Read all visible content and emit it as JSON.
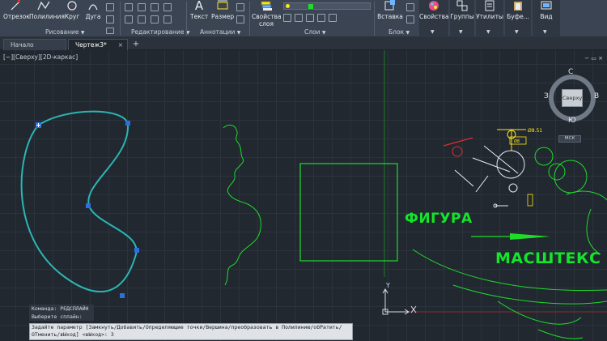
{
  "ribbon": {
    "draw_tools": [
      "Отрезок",
      "Полилиния",
      "Круг",
      "Дуга"
    ],
    "modify_tools": [
      "Текст",
      "Размер"
    ],
    "layers_tool": [
      "Свойства",
      "слоя"
    ],
    "insert_tool": "Вставка",
    "right_tools": [
      "Свойства",
      "Группы",
      "Утилиты",
      "Буфе...",
      "Вид"
    ],
    "panels": {
      "draw": "Рисование",
      "modify": "Редактирование",
      "annotation": "Аннотации",
      "layers": "Слои",
      "block": "Блок"
    }
  },
  "tabs": [
    {
      "label": "Начало"
    },
    {
      "label": "Чертеж3*",
      "close": "×"
    }
  ],
  "tab_add": "+",
  "viewport": {
    "label": "[−][Сверху][2D-каркас]",
    "window_controls": "− ▭ ×"
  },
  "viewcube": {
    "north": "С",
    "south": "Ю",
    "west": "З",
    "east": "В",
    "face": "Сверху",
    "mcs": "МСК"
  },
  "annotations": {
    "dim_value": "Ø8.51",
    "dim_value2": "Ø8"
  },
  "labels": {
    "figure": "ФИГУРА",
    "scale": "МАСШТЕКС"
  },
  "ucs": {
    "y": "Y",
    "x": "X"
  },
  "command": {
    "history": [
      "Команда: РЕДСПЛАЙН",
      "Выберите сплайн:"
    ],
    "prompt_line1": "Задайте параметр [Замкнуть/Добавить/Определяющие точки/Вершина/преобразовать в Полилинию/обРатить/",
    "prompt_line2": "ОТменить/вЫход] <вЫход>: З"
  },
  "colors": {
    "spline": "#2bb6b4",
    "green_geometry": "#1fdc2a",
    "accent_red": "#e12c2c",
    "accent_yellow": "#ffe51a",
    "axis_red": "#8a2b2b"
  }
}
